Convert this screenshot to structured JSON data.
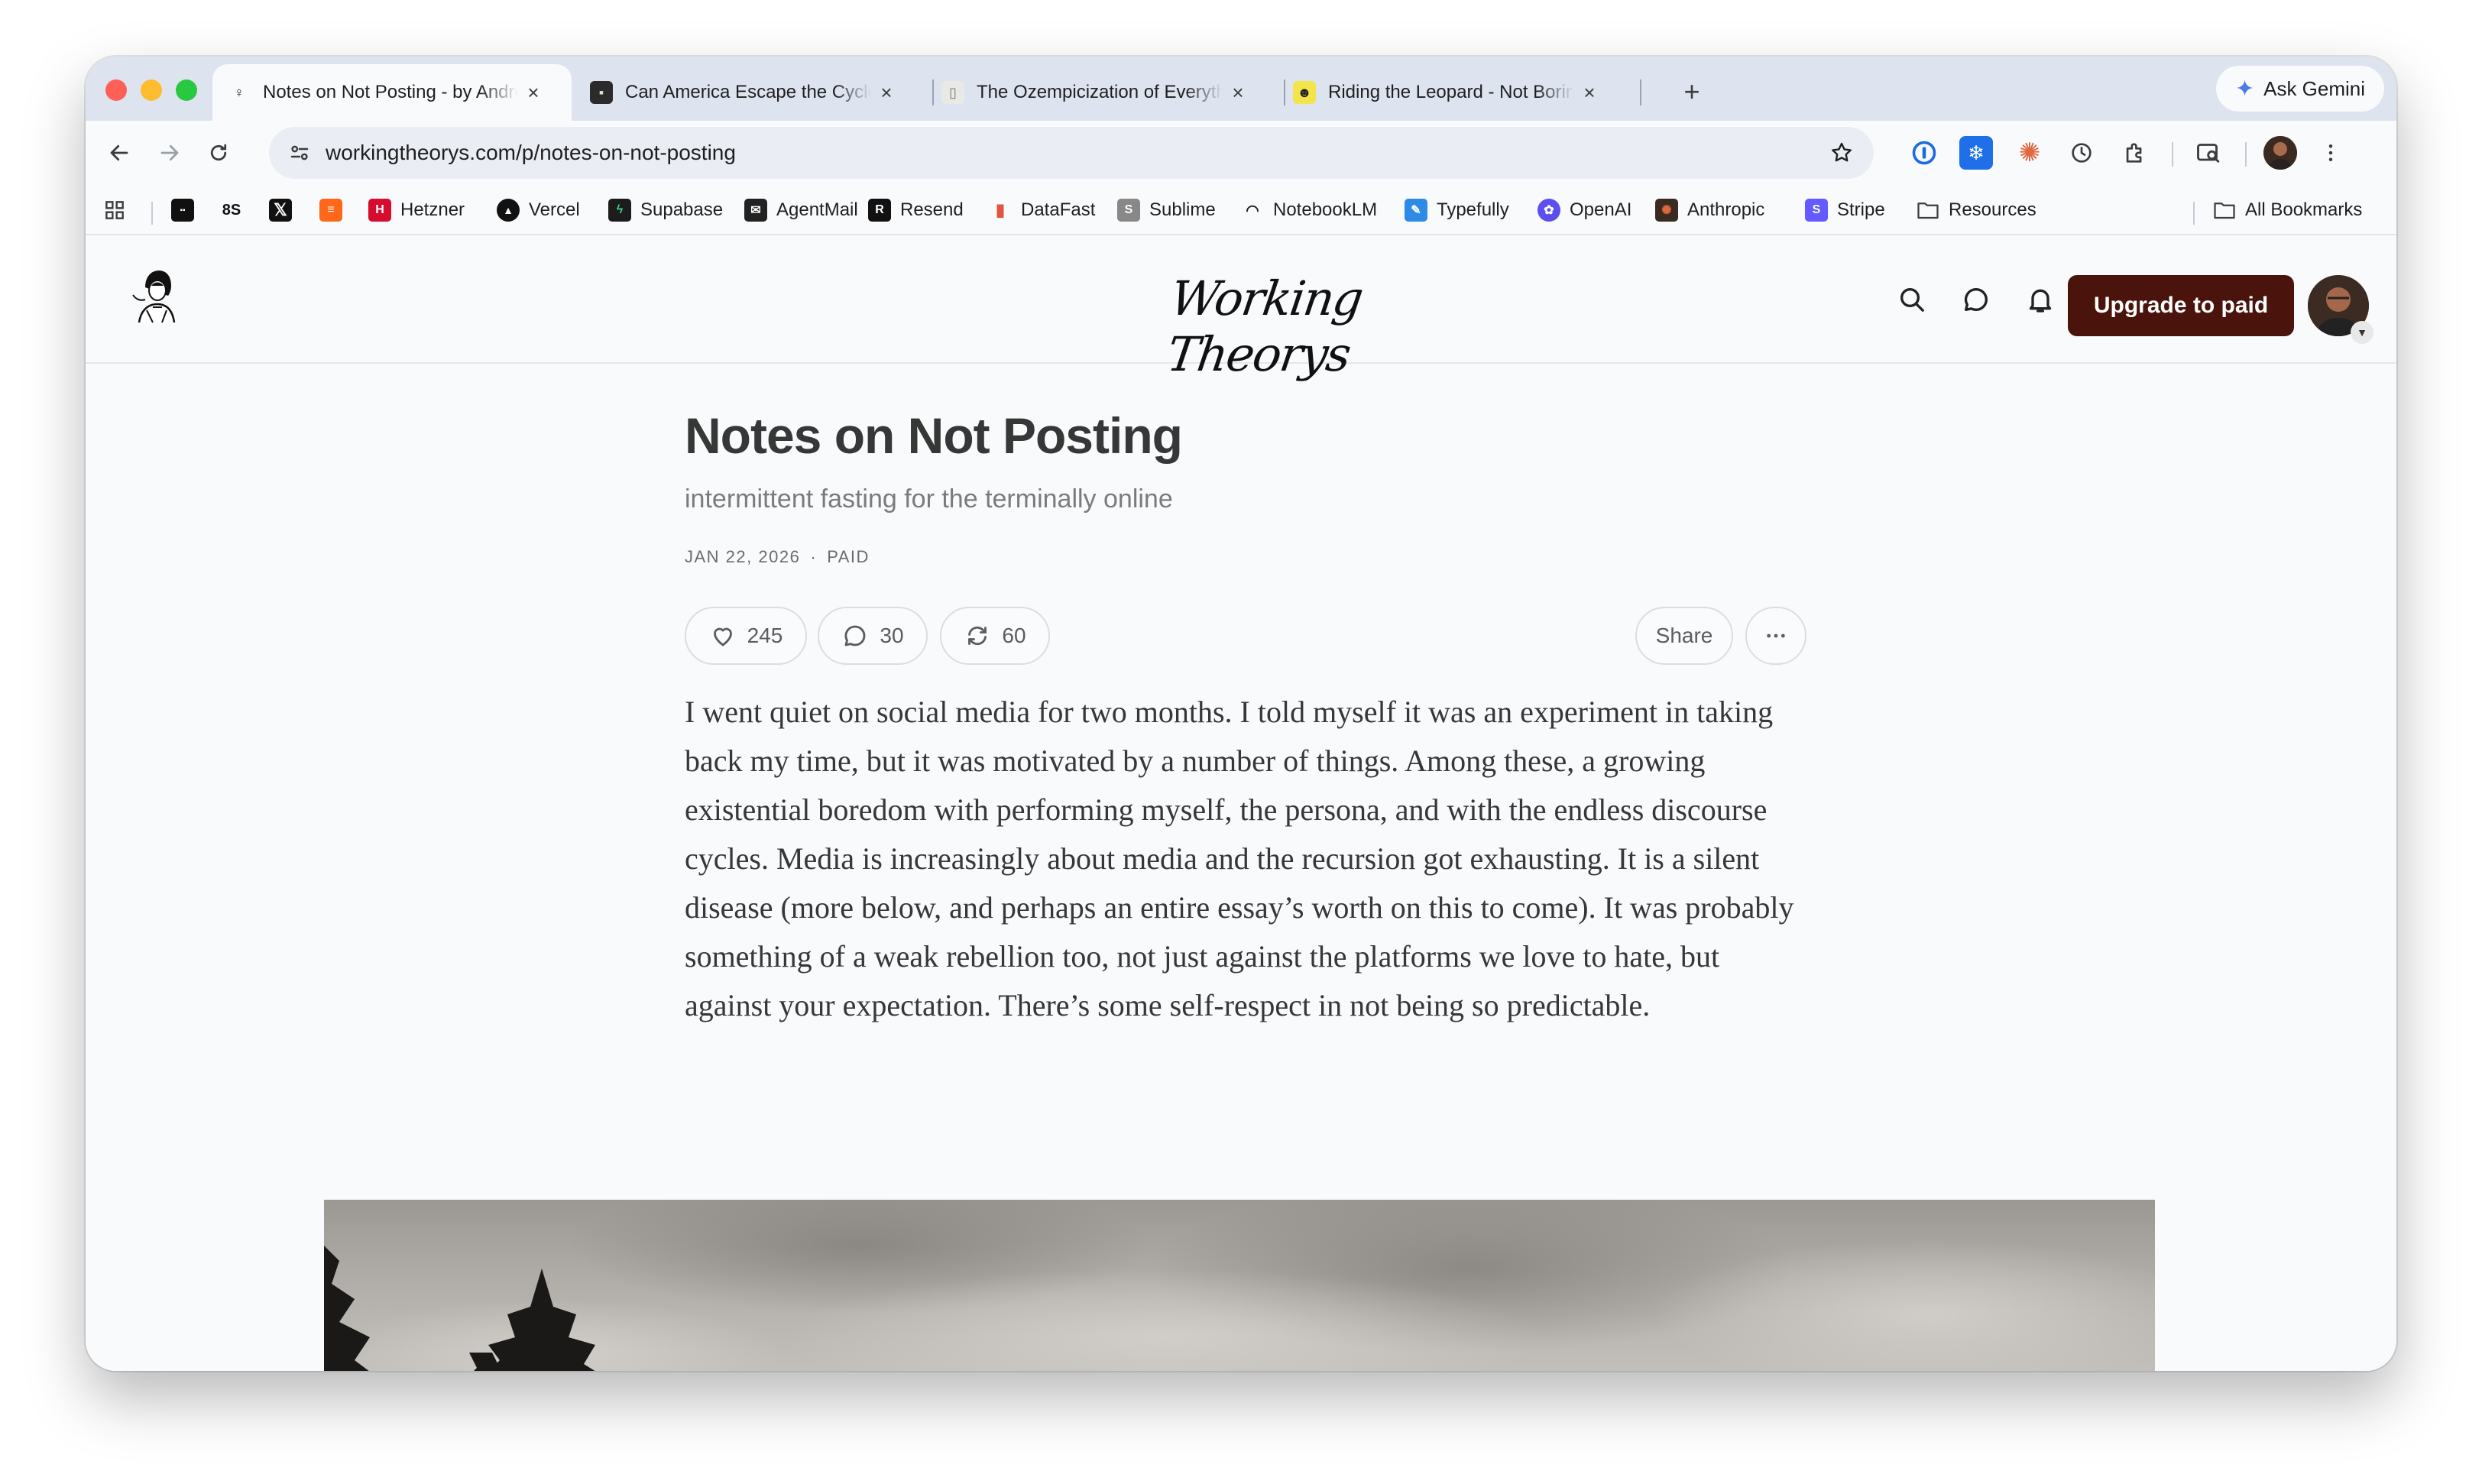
{
  "browser": {
    "tabs": [
      {
        "title": "Notes on Not Posting - by Andrew",
        "active": true
      },
      {
        "title": "Can America Escape the Cycle",
        "active": false
      },
      {
        "title": "The Ozempicization of Everything",
        "active": false
      },
      {
        "title": "Riding the Leopard - Not Boring",
        "active": false
      }
    ],
    "ask_gemini": "Ask Gemini",
    "url": "workingtheorys.com/p/notes-on-not-posting",
    "bookmarks": [
      "Hetzner",
      "Vercel",
      "Supabase",
      "AgentMail",
      "Resend",
      "DataFast",
      "Sublime",
      "NotebookLM",
      "Typefully",
      "OpenAI",
      "Anthropic",
      "Stripe",
      "Resources"
    ],
    "all_bookmarks": "All Bookmarks",
    "colors": {
      "tabstrip": "#dde3ef",
      "omnibox": "#eaeef4"
    }
  },
  "site": {
    "title": "Working Theorys",
    "upgrade_label": "Upgrade to paid",
    "accent": "#4a140c"
  },
  "post": {
    "title": "Notes on Not Posting",
    "subtitle": "intermittent fasting for the terminally online",
    "date": "JAN 22, 2026",
    "separator": "∙",
    "access": "PAID",
    "likes": "245",
    "comments": "30",
    "restacks": "60",
    "share_label": "Share",
    "body": "I went quiet on social media for two months. I told myself it was an experiment in taking back my time, but it was motivated by a number of things. Among these, a growing existential boredom with performing myself, the persona, and with the endless discourse cycles. Media is increasingly about media and the recursion got exhausting. It is a silent disease (more below, and perhaps an entire essay’s worth on this to come). It was probably something of a weak rebellion too, not just against the platforms we love to hate, but against your expectation. There’s some self-respect in not being so predictable."
  }
}
